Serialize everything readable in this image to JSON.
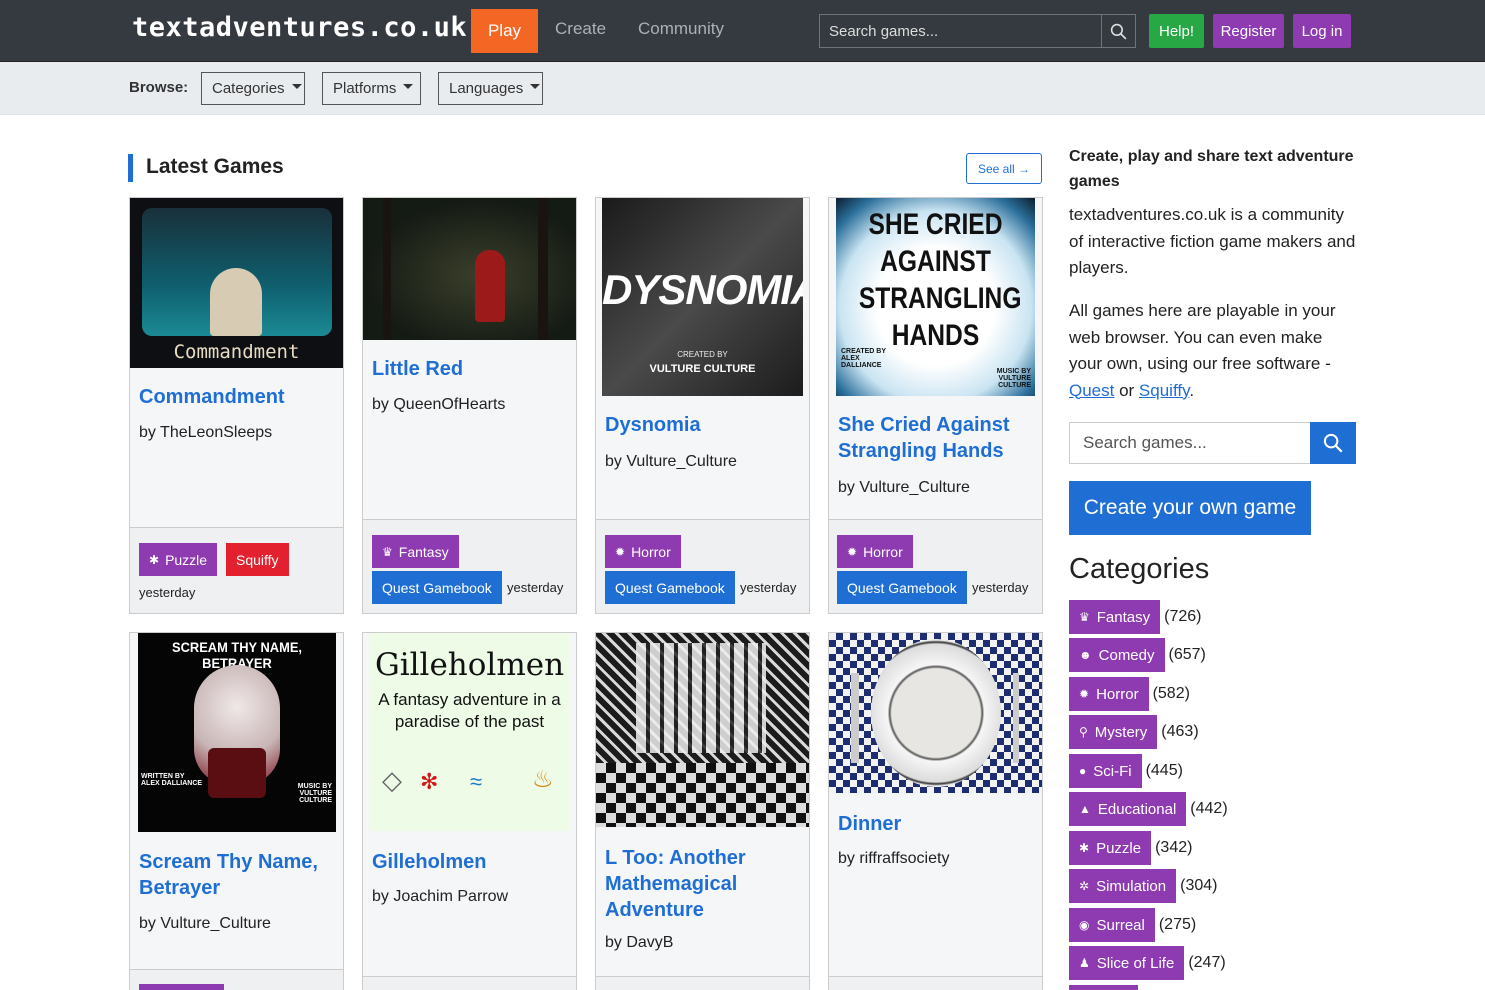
{
  "brand": "textadventures.co.uk",
  "nav": {
    "play": "Play",
    "create": "Create",
    "community": "Community"
  },
  "search": {
    "placeholder": "Search games..."
  },
  "buttons": {
    "help": "Help!",
    "register": "Register",
    "login": "Log in"
  },
  "browse": {
    "label": "Browse:",
    "categories": "Categories",
    "platforms": "Platforms",
    "languages": "Languages"
  },
  "section": {
    "title": "Latest Games",
    "see_all": "See all →"
  },
  "games": [
    {
      "title": "Commandment",
      "author": "by TheLeonSleeps",
      "tags": [
        "Puzzle",
        "Squiffy"
      ],
      "when": "yesterday",
      "cover_text": "Commandment"
    },
    {
      "title": "Little Red",
      "author": "by QueenOfHearts",
      "tags": [
        "Fantasy",
        "Quest Gamebook"
      ],
      "when": "yesterday"
    },
    {
      "title": "Dysnomia",
      "author": "by Vulture_Culture",
      "tags": [
        "Horror",
        "Quest Gamebook"
      ],
      "when": "yesterday",
      "cover_text": "DYSNOMIA",
      "cover_sub1": "CREATED BY",
      "cover_sub2": "VULTURE CULTURE"
    },
    {
      "title": "She Cried Against Strangling Hands",
      "author": "by Vulture_Culture",
      "tags": [
        "Horror",
        "Quest Gamebook"
      ],
      "when": "yesterday",
      "cover_text": "SHE CRIED AGAINST STRANGLING HANDS",
      "cover_sub1": "CREATED BY ALEX DALLIANCE",
      "cover_sub2": "MUSIC BY VULTURE CULTURE"
    },
    {
      "title": "Scream Thy Name, Betrayer",
      "author": "by Vulture_Culture",
      "cover_text": "SCREAM THY NAME, BETRAYER",
      "cover_sub1": "WRITTEN BY ALEX DALLIANCE",
      "cover_sub2": "MUSIC BY VULTURE CULTURE"
    },
    {
      "title": "Gilleholmen",
      "author": "by Joachim Parrow",
      "cover_text": "Gilleholmen",
      "cover_sub1": "A fantasy adventure in a paradise of the past"
    },
    {
      "title": "L Too: Another Mathemagical Adventure",
      "author": "by DavyB"
    },
    {
      "title": "Dinner",
      "author": "by riffraffsociety"
    }
  ],
  "sidebar": {
    "heading": "Create, play and share text adventure games",
    "p1": "textadventures.co.uk is a community of interactive fiction game makers and players.",
    "p2_pre": "All games here are playable in your web browser. You can even make your own, using our free software - ",
    "p2_link1": "Quest",
    "p2_mid": " or ",
    "p2_link2": "Squiffy",
    "p2_end": ".",
    "search_placeholder": "Search games...",
    "create_button": "Create your own game",
    "categories_title": "Categories",
    "categories": [
      {
        "name": "Fantasy",
        "count": "(726)",
        "icon": "crown-icon"
      },
      {
        "name": "Comedy",
        "count": "(657)",
        "icon": "smile-icon"
      },
      {
        "name": "Horror",
        "count": "(582)",
        "icon": "spider-icon"
      },
      {
        "name": "Mystery",
        "count": "(463)",
        "icon": "magnifier-icon"
      },
      {
        "name": "Sci-Fi",
        "count": "(445)",
        "icon": "alien-icon"
      },
      {
        "name": "Educational",
        "count": "(442)",
        "icon": "graduation-cap-icon"
      },
      {
        "name": "Puzzle",
        "count": "(342)",
        "icon": "puzzle-icon"
      },
      {
        "name": "Simulation",
        "count": "(304)",
        "icon": "gear-icon"
      },
      {
        "name": "Surreal",
        "count": "(275)",
        "icon": "spiral-icon"
      },
      {
        "name": "Slice of Life",
        "count": "(247)",
        "icon": "walking-person-icon"
      }
    ]
  },
  "colors": {
    "play": "#f46624",
    "purple": "#8e3bb1",
    "blue": "#1f6ed4",
    "green": "#28a745",
    "red": "#e3202e",
    "nav_bg": "#343a40"
  }
}
